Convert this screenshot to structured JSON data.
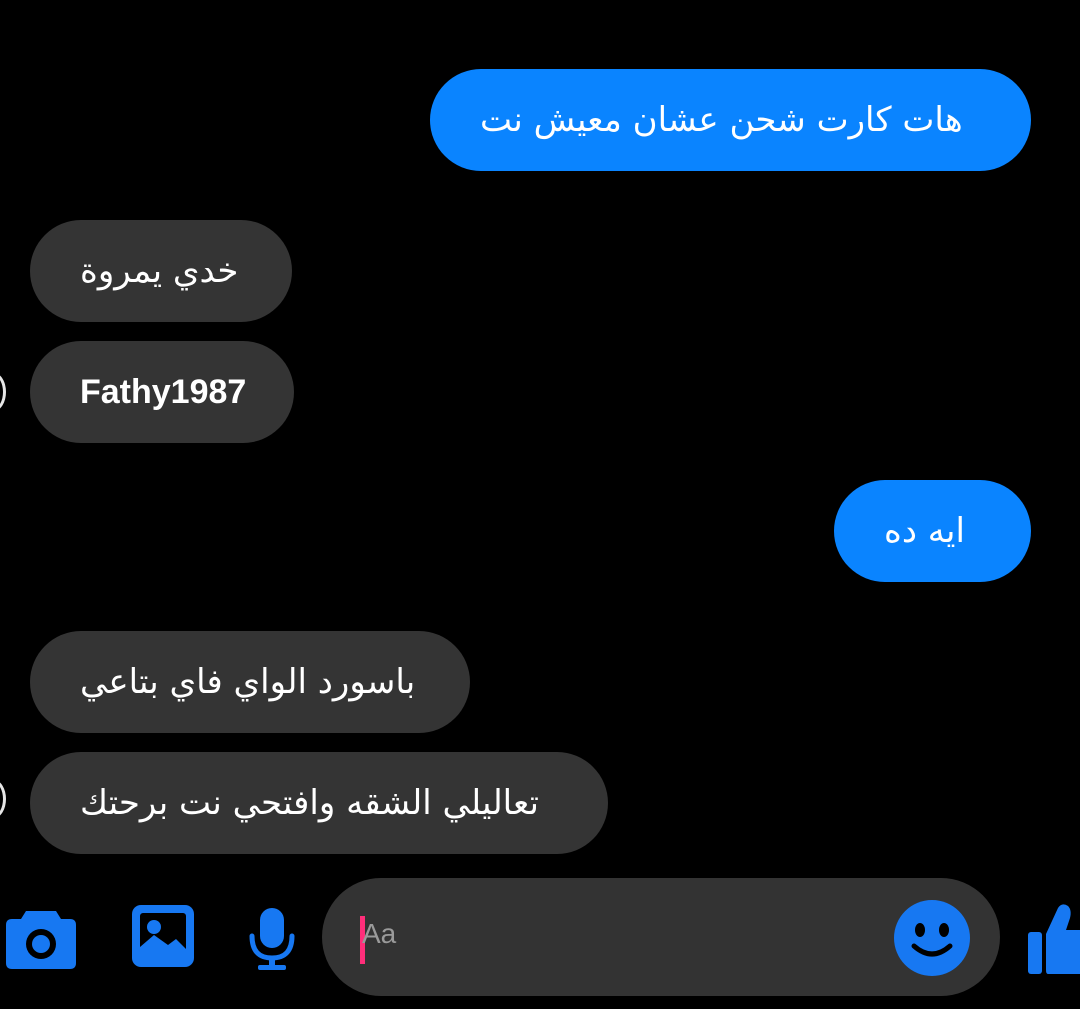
{
  "messages": [
    {
      "side": "sent",
      "text": "هات كارت شحن عشان معيش نت"
    },
    {
      "side": "received",
      "text": "خدي يمروة"
    },
    {
      "side": "received",
      "text": "Fathy1987"
    },
    {
      "side": "sent",
      "text": "ايه ده"
    },
    {
      "side": "received",
      "text": "باسورد الواي فاي بتاعي"
    },
    {
      "side": "received",
      "text": "تعاليلي الشقه وافتحي نت برحتك"
    }
  ],
  "composer": {
    "placeholder": "Aa"
  },
  "icons": {
    "camera": "camera-icon",
    "gallery": "image-gallery-icon",
    "microphone": "microphone-icon",
    "emoji": "emoji-smile-icon",
    "like": "thumbs-up-icon"
  },
  "colors": {
    "background": "#000000",
    "sent_bubble": "#0a84ff",
    "received_bubble": "#343434",
    "accent_blue": "#1778f2",
    "caret": "#ff2e7a"
  }
}
